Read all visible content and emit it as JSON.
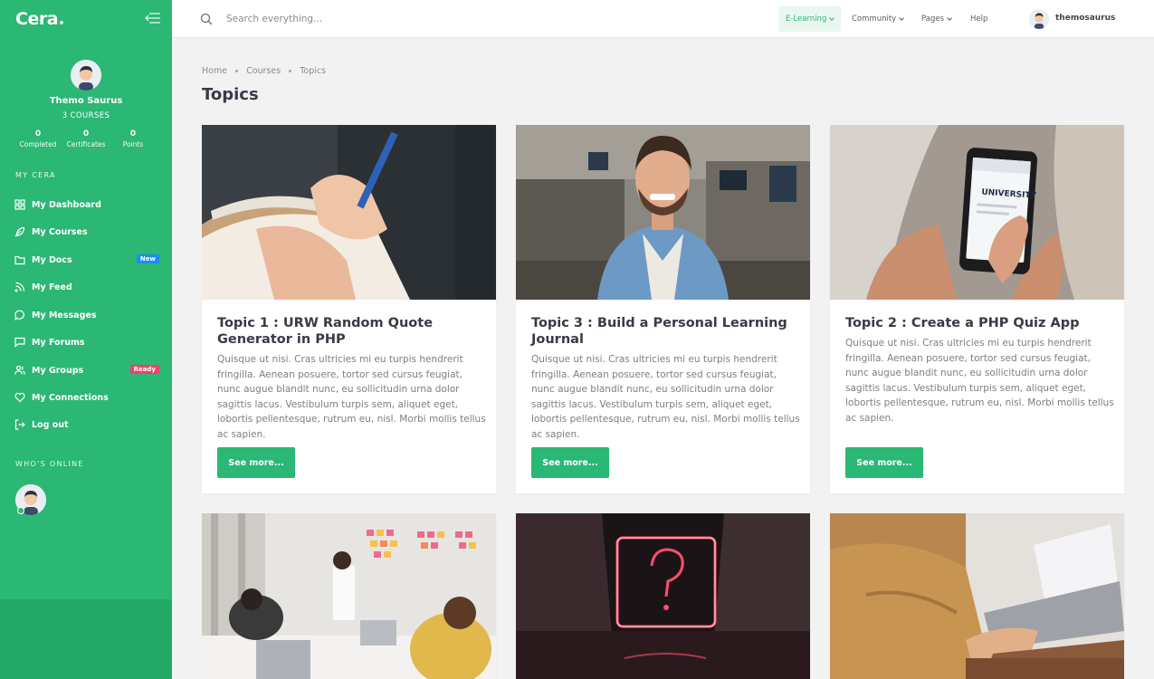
{
  "brand": {
    "name": "Cera"
  },
  "profile": {
    "name": "Themo Saurus",
    "courses": "3 COURSES",
    "stats": [
      {
        "value": "0",
        "label": "Completed"
      },
      {
        "value": "0",
        "label": "Certificates"
      },
      {
        "value": "0",
        "label": "Points"
      }
    ]
  },
  "sidebar": {
    "section_title": "MY CERA",
    "items": [
      {
        "label": "My Dashboard",
        "icon": "grid-icon"
      },
      {
        "label": "My Courses",
        "icon": "feather-icon"
      },
      {
        "label": "My Docs",
        "icon": "folder-icon",
        "badge": "New"
      },
      {
        "label": "My Feed",
        "icon": "rss-icon"
      },
      {
        "label": "My Messages",
        "icon": "message-circle-icon"
      },
      {
        "label": "My Forums",
        "icon": "message-square-icon"
      },
      {
        "label": "My Groups",
        "icon": "users-icon",
        "badge": "Ready"
      },
      {
        "label": "My Connections",
        "icon": "heart-icon"
      },
      {
        "label": "Log out",
        "icon": "log-out-icon"
      }
    ],
    "online_title": "WHO'S ONLINE"
  },
  "topbar": {
    "search_placeholder": "Search everything...",
    "menu": [
      "E-Learning",
      "Community",
      "Pages",
      "Help"
    ],
    "username": "themosaurus"
  },
  "breadcrumb": [
    "Home",
    "Courses",
    "Topics"
  ],
  "page_title": "Topics",
  "cards": [
    {
      "title": "Topic 1 : URW Random Quote Generator in PHP",
      "body": "Quisque ut nisi. Cras ultricies mi eu turpis hendrerit fringilla. Aenean posuere, tortor sed cursus feugiat, nunc augue blandit nunc, eu sollicitudin urna dolor sagittis lacus. Vestibulum turpis sem, aliquet eget, lobortis pellentesque, rutrum eu, nisl. Morbi mollis tellus ac sapien.",
      "button": "See more..."
    },
    {
      "title": "Topic 3 : Build a Personal Learning Journal",
      "body": "Quisque ut nisi. Cras ultricies mi eu turpis hendrerit fringilla. Aenean posuere, tortor sed cursus feugiat, nunc augue blandit nunc, eu sollicitudin urna dolor sagittis lacus. Vestibulum turpis sem, aliquet eget, lobortis pellentesque, rutrum eu, nisl. Morbi mollis tellus ac sapien.",
      "button": "See more..."
    },
    {
      "title": "Topic 2 : Create a PHP Quiz App",
      "body": "Quisque ut nisi. Cras ultricies mi eu turpis hendrerit fringilla. Aenean posuere, tortor sed cursus feugiat, nunc augue blandit nunc, eu sollicitudin urna dolor sagittis lacus. Vestibulum turpis sem, aliquet eget, lobortis pellentesque, rutrum eu, nisl. Morbi mollis tellus ac sapien.",
      "button": "See more..."
    }
  ],
  "phone_screen_text": "UNIVERSITY",
  "colors": {
    "primary": "#2bb774",
    "badge_new": "#1d8cf8",
    "badge_ready": "#f0406a"
  }
}
